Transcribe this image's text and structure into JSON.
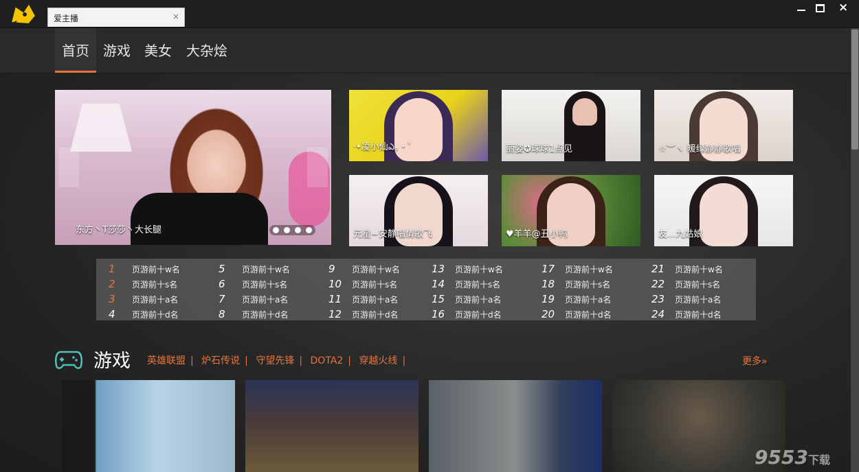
{
  "window": {
    "tab_title": "爱主播",
    "tab_close_glyph": "×",
    "close_glyph": "×"
  },
  "nav": {
    "items": [
      {
        "label": "首页",
        "active": true
      },
      {
        "label": "游戏",
        "active": false
      },
      {
        "label": "美女",
        "active": false
      },
      {
        "label": "大杂烩",
        "active": false
      }
    ]
  },
  "banner": {
    "caption": "东方丶T莎莎丶大长腿",
    "slide_count": 4
  },
  "thumbs": [
    {
      "caption": "·•凌小仙ఎ。·ﾟ"
    },
    {
      "caption": "丽姿✪球球1点见"
    },
    {
      "caption": "☆︶ヽ  暖绿静静歌唱"
    },
    {
      "caption": "元星~安静唱情歌飞"
    },
    {
      "caption": "♥羊羊@丑小鸭"
    },
    {
      "caption": "友...九姑娘"
    }
  ],
  "ranking": {
    "columns": [
      {
        "rows": [
          {
            "num": "1",
            "name": "页游前十w名"
          },
          {
            "num": "2",
            "name": "页游前十s名"
          },
          {
            "num": "3",
            "name": "页游前十a名"
          },
          {
            "num": "4",
            "name": "页游前十d名"
          }
        ]
      },
      {
        "rows": [
          {
            "num": "5",
            "name": "页游前十w名"
          },
          {
            "num": "6",
            "name": "页游前十s名"
          },
          {
            "num": "7",
            "name": "页游前十a名"
          },
          {
            "num": "8",
            "name": "页游前十d名"
          }
        ]
      },
      {
        "rows": [
          {
            "num": "9",
            "name": "页游前十w名"
          },
          {
            "num": "10",
            "name": "页游前十s名"
          },
          {
            "num": "11",
            "name": "页游前十a名"
          },
          {
            "num": "12",
            "name": "页游前十d名"
          }
        ]
      },
      {
        "rows": [
          {
            "num": "13",
            "name": "页游前十w名"
          },
          {
            "num": "14",
            "name": "页游前十s名"
          },
          {
            "num": "15",
            "name": "页游前十a名"
          },
          {
            "num": "16",
            "name": "页游前十d名"
          }
        ]
      },
      {
        "rows": [
          {
            "num": "17",
            "name": "页游前十w名"
          },
          {
            "num": "18",
            "name": "页游前十s名"
          },
          {
            "num": "19",
            "name": "页游前十a名"
          },
          {
            "num": "20",
            "name": "页游前十d名"
          }
        ]
      },
      {
        "rows": [
          {
            "num": "21",
            "name": "页游前十w名"
          },
          {
            "num": "22",
            "name": "页游前十s名"
          },
          {
            "num": "23",
            "name": "页游前十a名"
          },
          {
            "num": "24",
            "name": "页游前十d名"
          }
        ]
      }
    ]
  },
  "games_section": {
    "title": "游戏",
    "links": [
      "英雄联盟",
      "炉石传说",
      "守望先锋",
      "DOTA2",
      "穿越火线"
    ],
    "separator": "|",
    "more_label": "更多»"
  },
  "watermark": {
    "text": "9553",
    "suffix": "下载"
  },
  "colors": {
    "accent": "#e8743b",
    "background": "#2a2a2a",
    "ranking_bg": "#5f5f5f"
  },
  "icons": [
    "app-logo-icon",
    "minimize-icon",
    "maximize-icon",
    "close-icon",
    "gamepad-icon",
    "arrow-left-icon",
    "arrow-right-icon"
  ]
}
